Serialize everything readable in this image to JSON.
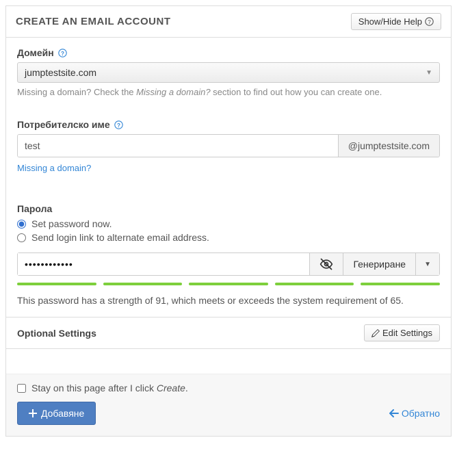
{
  "header": {
    "title": "CREATE AN EMAIL ACCOUNT",
    "help_button": "Show/Hide Help"
  },
  "domain": {
    "label": "Домейн",
    "selected": "jumptestsite.com",
    "hint_prefix": "Missing a domain? Check the ",
    "hint_em": "Missing a domain?",
    "hint_suffix": " section to find out how you can create one."
  },
  "username": {
    "label": "Потребителско име",
    "value": "test",
    "suffix": "@jumptestsite.com",
    "link": "Missing a domain?"
  },
  "password": {
    "label": "Парола",
    "option_now": "Set password now.",
    "option_link": "Send login link to alternate email address.",
    "value": "••••••••••••",
    "generate": "Генериране",
    "strength_text": "This password has a strength of 91, which meets or exceeds the system requirement of 65."
  },
  "optional": {
    "label": "Optional Settings",
    "button": "Edit Settings"
  },
  "footer": {
    "stay_prefix": "Stay on this page after I click ",
    "stay_em": "Create",
    "stay_suffix": ".",
    "add": "Добавяне",
    "back": "Обратно"
  }
}
